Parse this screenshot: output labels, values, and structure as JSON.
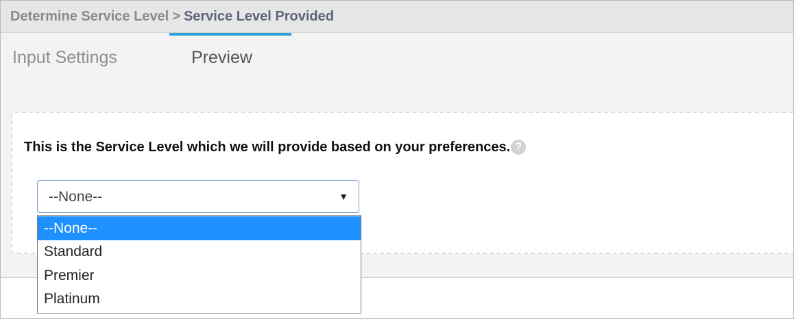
{
  "header": {
    "breadcrumb_parent": "Determine Service Level",
    "breadcrumb_separator": ">",
    "breadcrumb_current": "Service Level Provided"
  },
  "tabs": [
    {
      "label": "Input Settings",
      "active": false
    },
    {
      "label": "Preview",
      "active": true
    }
  ],
  "colors": {
    "accent": "#2aa1d9",
    "selected_option_bg": "#1e90ff",
    "header_bg": "#e6e6e6",
    "content_bg": "#f3f3f3"
  },
  "form": {
    "question": "This is the Service Level which we will provide based on your preferences.",
    "help_icon": "question-circle-icon",
    "help_glyph": "?",
    "select": {
      "value": "--None--",
      "arrow_glyph": "▼",
      "options": [
        {
          "label": "--None--",
          "selected": true
        },
        {
          "label": "Standard",
          "selected": false
        },
        {
          "label": "Premier",
          "selected": false
        },
        {
          "label": "Platinum",
          "selected": false
        }
      ]
    }
  }
}
